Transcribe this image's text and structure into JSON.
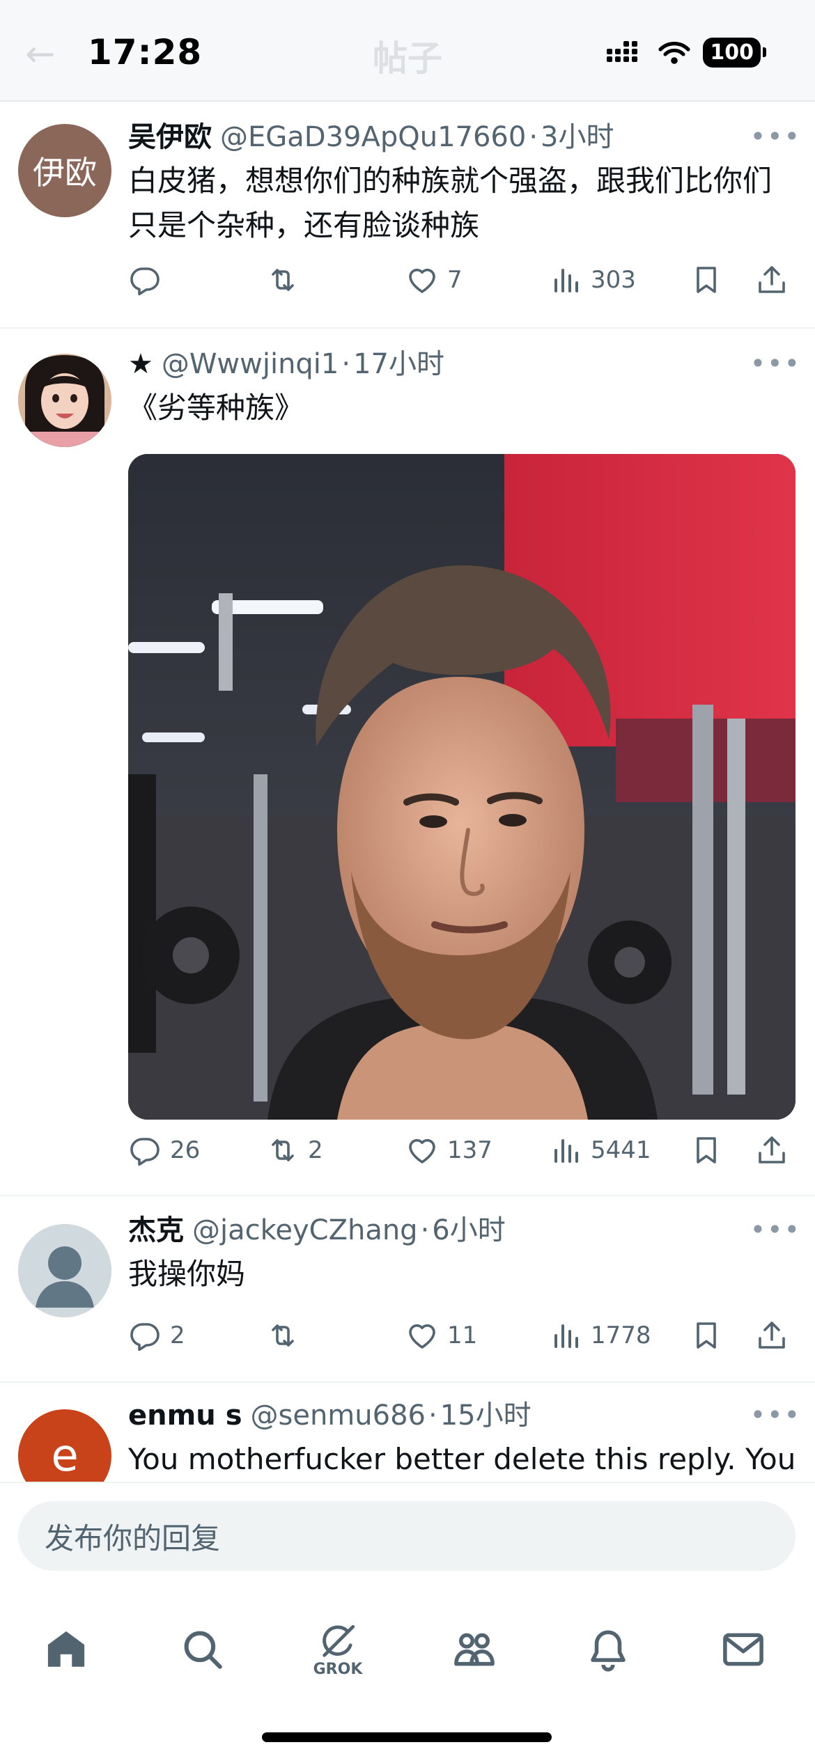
{
  "status_bar": {
    "time": "17:28",
    "battery": "100"
  },
  "header": {
    "title": "帖子"
  },
  "tweets": [
    {
      "avatar_text": "伊欧",
      "name": "吴伊欧",
      "handle": "@EGaD39ApQu17660",
      "time": "3小时",
      "text": "白皮猪，想想你们的种族就个强盗，跟我们比你们只是个杂种，还有脸谈种族",
      "replies": "",
      "retweets": "",
      "likes": "7",
      "views": "303"
    },
    {
      "name": "★",
      "handle": "@Wwwjinqi1",
      "time": "17小时",
      "text": "《劣等种族》",
      "replies": "26",
      "retweets": "2",
      "likes": "137",
      "views": "5441"
    },
    {
      "name": "杰克",
      "handle": "@jackeyCZhang",
      "time": "6小时",
      "text": "我操你妈",
      "replies": "2",
      "retweets": "",
      "likes": "11",
      "views": "1778"
    },
    {
      "avatar_text": "e",
      "name": "enmu s",
      "handle": "@senmu686",
      "time": "15小时",
      "text": "You motherfucker better delete this reply. You"
    }
  ],
  "reply_box": {
    "placeholder": "发布你的回复"
  },
  "tabbar": {
    "grok_label": "GROK"
  },
  "colors": {
    "text_primary": "#0f1419",
    "text_secondary": "#536471",
    "divider": "#eff3f4",
    "avatar1": "#8a6758",
    "avatar4": "#c8421a"
  }
}
